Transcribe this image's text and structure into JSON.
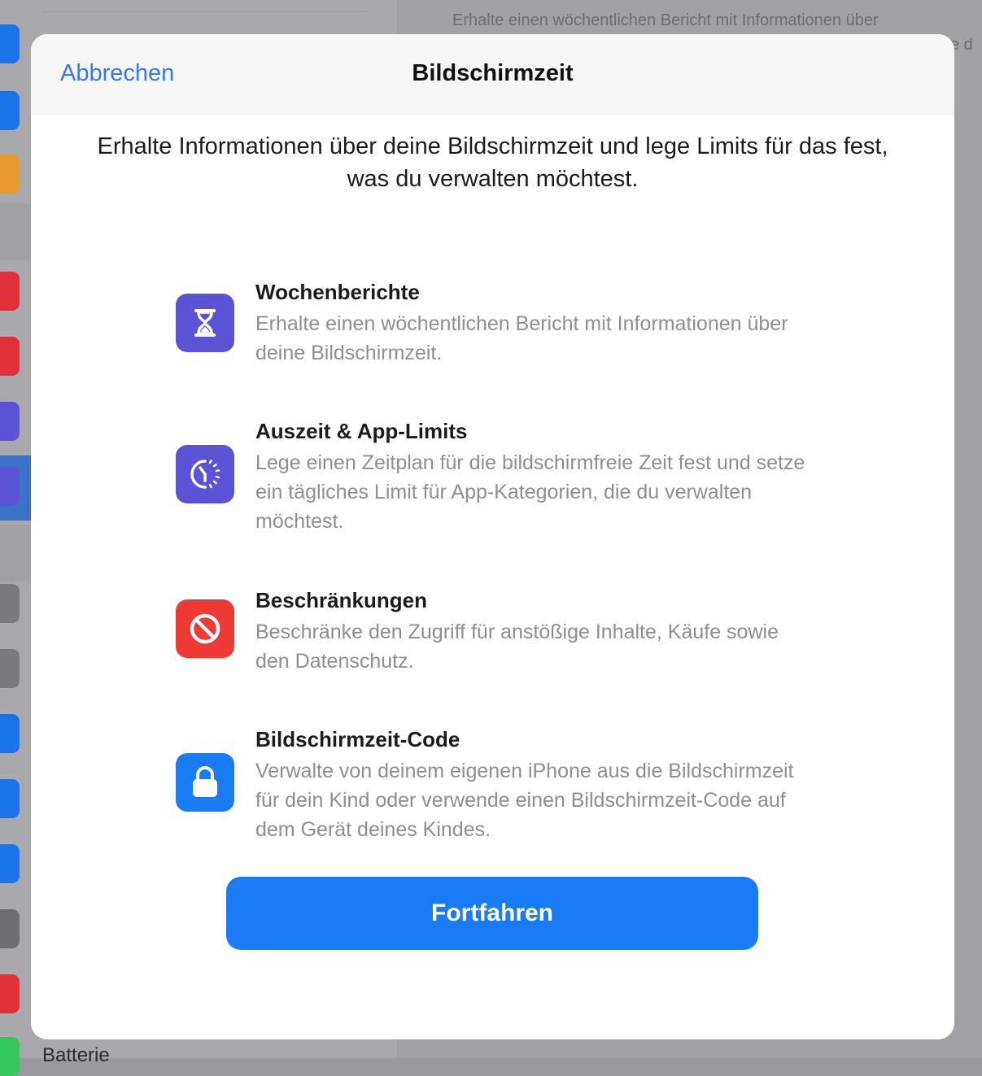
{
  "background": {
    "detail_text_line1": "Erhalte einen wöchentlichen Bericht mit Informationen über",
    "detail_text_line2": "e d",
    "sidebar_bottom_text": "Batterie",
    "strip_icon_colors": [
      "#1a73e8",
      "#1a73e8",
      "#e89a2c",
      "#e0303a",
      "#e0303a",
      "#5b52d4",
      "#5b52d4",
      "#7a7a7e",
      "#7a7a7e",
      "#1a73e8",
      "#1a73e8",
      "#1a73e8",
      "#6e6e72",
      "#e0303a",
      "#34c759"
    ]
  },
  "modal": {
    "cancel_label": "Abbrechen",
    "title": "Bildschirmzeit",
    "intro": "Erhalte Informationen über deine Bildschirmzeit und lege Limits für das fest, was du verwalten möchtest.",
    "features": [
      {
        "icon": "hourglass-icon",
        "icon_color": "#5b52d4",
        "title": "Wochenberichte",
        "description": "Erhalte einen wöchentlichen Bericht mit Informationen über deine Bildschirmzeit."
      },
      {
        "icon": "downtime-clock-icon",
        "icon_color": "#5b52d4",
        "title": "Auszeit & App-Limits",
        "description": "Lege einen Zeitplan für die bildschirmfreie Zeit fest und setze ein tägliches Limit für App-Kategorien, die du verwalten möchtest."
      },
      {
        "icon": "restriction-icon",
        "icon_color": "#ee3a34",
        "title": "Beschränkungen",
        "description": "Beschränke den Zugriff für anstößige Inhalte, Käufe sowie den Datenschutz."
      },
      {
        "icon": "lock-icon",
        "icon_color": "#1a7cf4",
        "title": "Bildschirmzeit-Code",
        "description": "Verwalte von deinem eigenen iPhone aus die Bildschirmzeit für dein Kind oder verwende einen Bildschirmzeit-Code auf dem Gerät deines Kindes."
      }
    ],
    "continue_label": "Fortfahren"
  }
}
